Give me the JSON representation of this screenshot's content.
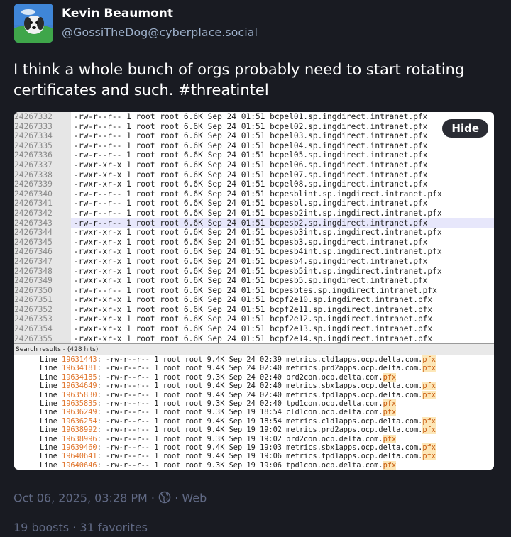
{
  "author": {
    "name": "Kevin Beaumont",
    "handle": "@GossiTheDog@cyberplace.social"
  },
  "post": {
    "text": "I think a whole bunch of orgs probably need to start rotating certificates and such. #threatintel",
    "timestamp": "Oct 06, 2025, 03:28 PM",
    "visibility_icon": "globe-icon",
    "application": "Web",
    "boosts": "19 boosts",
    "favorites": "31 favorites"
  },
  "media": {
    "hide_label": "Hide",
    "terminal_rows": [
      {
        "num": "24267332",
        "text": "-rw-r--r-- 1 root root 6.6K Sep 24 01:51 bcpel01.sp.ingdirect.intranet.pfx"
      },
      {
        "num": "24267333",
        "text": "-rw-r--r-- 1 root root 6.6K Sep 24 01:51 bcpel02.sp.ingdirect.intranet.pfx"
      },
      {
        "num": "24267334",
        "text": "-rw-r--r-- 1 root root 6.6K Sep 24 01:51 bcpel03.sp.ingdirect.intranet.pfx"
      },
      {
        "num": "24267335",
        "text": "-rw-r--r-- 1 root root 6.6K Sep 24 01:51 bcpel04.sp.ingdirect.intranet.pfx"
      },
      {
        "num": "24267336",
        "text": "-rw-r--r-- 1 root root 6.6K Sep 24 01:51 bcpel05.sp.ingdirect.intranet.pfx"
      },
      {
        "num": "24267337",
        "text": "-rwxr-xr-x 1 root root 6.6K Sep 24 01:51 bcpel06.sp.ingdirect.intranet.pfx"
      },
      {
        "num": "24267338",
        "text": "-rwxr-xr-x 1 root root 6.6K Sep 24 01:51 bcpel07.sp.ingdirect.intranet.pfx"
      },
      {
        "num": "24267339",
        "text": "-rwxr-xr-x 1 root root 6.6K Sep 24 01:51 bcpel08.sp.ingdirect.intranet.pfx"
      },
      {
        "num": "24267340",
        "text": "-rw-r--r-- 1 root root 6.6K Sep 24 01:51 bcpesblint.sp.ingdirect.intranet.pfx"
      },
      {
        "num": "24267341",
        "text": "-rw-r--r-- 1 root root 6.6K Sep 24 01:51 bcpesbl.sp.ingdirect.intranet.pfx"
      },
      {
        "num": "24267342",
        "text": "-rw-r--r-- 1 root root 6.6K Sep 24 01:51 bcpesb2int.sp.ingdirect.intranet.pfx"
      },
      {
        "num": "24267343",
        "text": "-rw-r--r-- 1 root root 6.6K Sep 24 01:51 bcpesb2.sp.ingdirect.intranet.pfx"
      },
      {
        "num": "24267344",
        "text": "-rwxr-xr-x 1 root root 6.6K Sep 24 01:51 bcpesb3int.sp.ingdirect.intranet.pfx"
      },
      {
        "num": "24267345",
        "text": "-rwxr-xr-x 1 root root 6.6K Sep 24 01:51 bcpesb3.sp.ingdirect.intranet.pfx"
      },
      {
        "num": "24267346",
        "text": "-rwxr-xr-x 1 root root 6.6K Sep 24 01:51 bcpesb4int.sp.ingdirect.intranet.pfx"
      },
      {
        "num": "24267347",
        "text": "-rwxr-xr-x 1 root root 6.6K Sep 24 01:51 bcpesb4.sp.ingdirect.intranet.pfx"
      },
      {
        "num": "24267348",
        "text": "-rwxr-xr-x 1 root root 6.6K Sep 24 01:51 bcpesb5int.sp.ingdirect.intranet.pfx"
      },
      {
        "num": "24267349",
        "text": "-rwxr-xr-x 1 root root 6.6K Sep 24 01:51 bcpesb5.sp.ingdirect.intranet.pfx"
      },
      {
        "num": "24267350",
        "text": "-rw-r--r-- 1 root root 6.6K Sep 24 01:51 bcpesbtes.sp.ingdirect.intranet.pfx"
      },
      {
        "num": "24267351",
        "text": "-rwxr-xr-x 1 root root 6.6K Sep 24 01:51 bcpf2e10.sp.ingdirect.intranet.pfx"
      },
      {
        "num": "24267352",
        "text": "-rwxr-xr-x 1 root root 6.6K Sep 24 01:51 bcpf2e11.sp.ingdirect.intranet.pfx"
      },
      {
        "num": "24267353",
        "text": "-rwxr-xr-x 1 root root 6.6K Sep 24 01:51 bcpf2e12.sp.ingdirect.intranet.pfx"
      },
      {
        "num": "24267354",
        "text": "-rwxr-xr-x 1 root root 6.6K Sep 24 01:51 bcpf2e13.sp.ingdirect.intranet.pfx"
      },
      {
        "num": "24267355",
        "text": "-rwxr-xr-x 1 root root 6.6K Sep 24 01:51 bcpf2e14.sp.ingdirect.intranet.pfx"
      }
    ],
    "highlight_row_num": "24267343",
    "search_header": "Search results - (428 hits)",
    "search_rows": [
      {
        "line": "19631443",
        "text": "-rw-r--r-- 1 root root 9.4K Sep 24 02:39 metrics.cld1apps.ocp.delta.com.",
        "ext": "pfx"
      },
      {
        "line": "19634181",
        "text": "-rw-r--r-- 1 root root 9.4K Sep 24 02:40 metrics.prd2apps.ocp.delta.com.",
        "ext": "pfx"
      },
      {
        "line": "19634185",
        "text": "-rw-r--r-- 1 root root 9.3K Sep 24 02:40 prd2con.ocp.delta.com.",
        "ext": "pfx"
      },
      {
        "line": "19634649",
        "text": "-rw-r--r-- 1 root root 9.4K Sep 24 02:40 metrics.sbx1apps.ocp.delta.com.",
        "ext": "pfx"
      },
      {
        "line": "19635830",
        "text": "-rw-r--r-- 1 root root 9.4K Sep 24 02:40 metrics.tpd1apps.ocp.delta.com.",
        "ext": "pfx"
      },
      {
        "line": "19635835",
        "text": "-rw-r--r-- 1 root root 9.3K Sep 24 02:40 tpd1con.ocp.delta.com.",
        "ext": "pfx"
      },
      {
        "line": "19636249",
        "text": "-rw-r--r-- 1 root root 9.3K Sep 19 18:54 cld1con.ocp.delta.com.",
        "ext": "pfx"
      },
      {
        "line": "19636254",
        "text": "-rw-r--r-- 1 root root 9.4K Sep 19 18:54 metrics.cld1apps.ocp.delta.com.",
        "ext": "pfx"
      },
      {
        "line": "19638992",
        "text": "-rw-r--r-- 1 root root 9.4K Sep 19 19:02 metrics.prd2apps.ocp.delta.com.",
        "ext": "pfx"
      },
      {
        "line": "19638996",
        "text": "-rw-r--r-- 1 root root 9.3K Sep 19 19:02 prd2con.ocp.delta.com.",
        "ext": "pfx"
      },
      {
        "line": "19639460",
        "text": "-rw-r--r-- 1 root root 9.4K Sep 19 19:03 metrics.sbx1apps.ocp.delta.com.",
        "ext": "pfx"
      },
      {
        "line": "19640641",
        "text": "-rw-r--r-- 1 root root 9.4K Sep 19 19:06 metrics.tpd1apps.ocp.delta.com.",
        "ext": "pfx"
      },
      {
        "line": "19640646",
        "text": "-rw-r--r-- 1 root root 9.3K Sep 19 19:06 tpd1con.ocp.delta.com.",
        "ext": "pfx"
      }
    ]
  },
  "colors": {
    "background": "#191b22",
    "muted": "#606984",
    "handle": "#9baec8",
    "line_number_orange": "#e0762e"
  }
}
